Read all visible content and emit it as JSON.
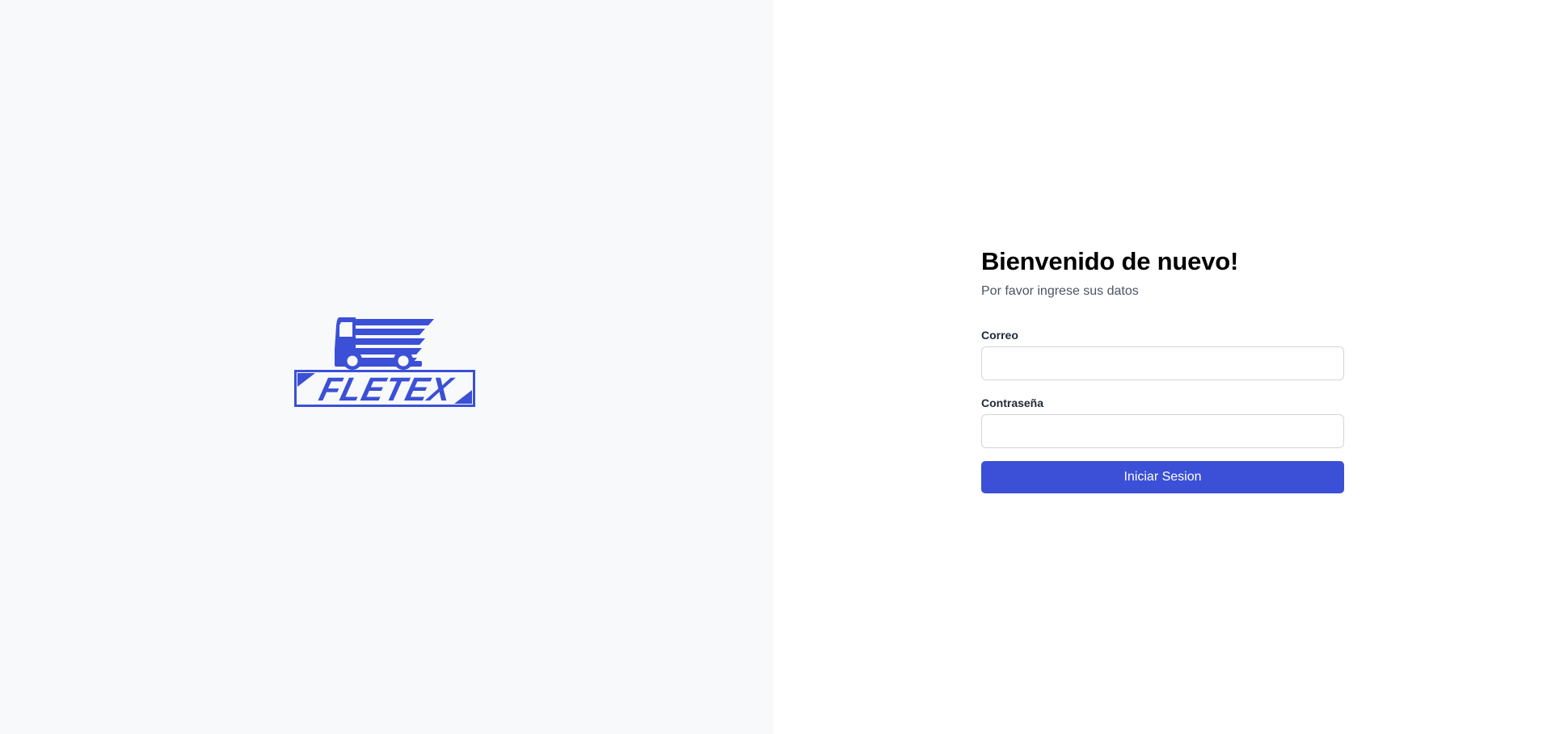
{
  "brand": {
    "logo_text": "FLETEX",
    "logo_icon": "truck-icon",
    "color": "#3b50d6"
  },
  "login": {
    "title": "Bienvenido de nuevo!",
    "subtitle": "Por favor ingrese sus datos",
    "email_label": "Correo",
    "email_value": "",
    "password_label": "Contraseña",
    "password_value": "",
    "submit_label": "Iniciar Sesion"
  },
  "colors": {
    "left_bg": "#f8f9fb",
    "right_bg": "#ffffff",
    "accent": "#3b50d6"
  }
}
